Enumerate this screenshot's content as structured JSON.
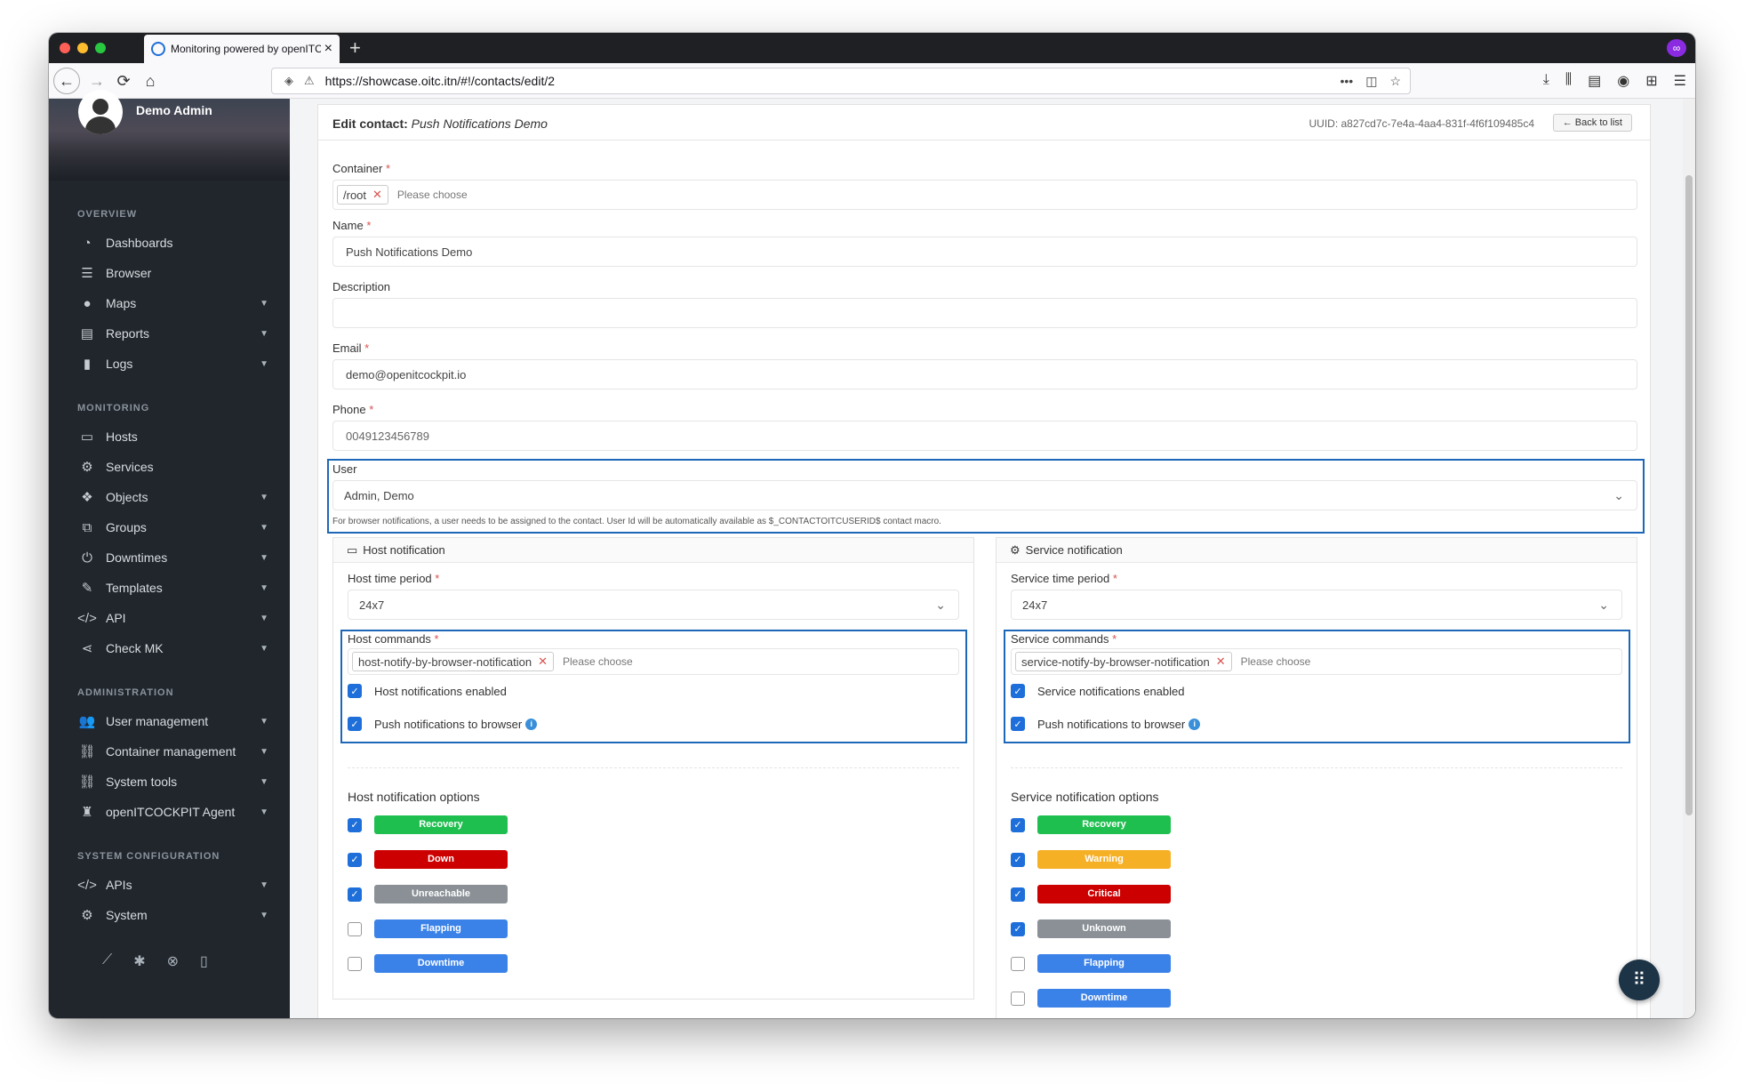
{
  "browser": {
    "tab_title": "Monitoring powered by openITC",
    "url": "https://showcase.oitc.itn/#!/contacts/edit/2"
  },
  "sidebar": {
    "user_name": "Demo Admin",
    "sections": {
      "overview": "OVERVIEW",
      "monitoring": "MONITORING",
      "administration": "ADMINISTRATION",
      "system_configuration": "SYSTEM CONFIGURATION"
    },
    "items": {
      "dashboards": "Dashboards",
      "browser": "Browser",
      "maps": "Maps",
      "reports": "Reports",
      "logs": "Logs",
      "hosts": "Hosts",
      "services": "Services",
      "objects": "Objects",
      "groups": "Groups",
      "downtimes": "Downtimes",
      "templates": "Templates",
      "api": "API",
      "checkmk": "Check MK",
      "user_management": "User management",
      "container_management": "Container management",
      "system_tools": "System tools",
      "agent": "openITCOCKPIT Agent",
      "apis": "APIs",
      "system": "System"
    }
  },
  "header": {
    "title_prefix": "Edit contact:",
    "title_name": "Push Notifications Demo",
    "uuid": "UUID: a827cd7c-7e4a-4aa4-831f-4f6f109485c4",
    "back_label": "← Back to list"
  },
  "form": {
    "container_label": "Container",
    "container_chip": "/root",
    "container_placeholder": "Please choose",
    "name_label": "Name",
    "name_value": "Push Notifications Demo",
    "description_label": "Description",
    "description_value": "",
    "email_label": "Email",
    "email_value": "demo@openitcockpit.io",
    "phone_label": "Phone",
    "phone_value": "0049123456789",
    "user_label": "User",
    "user_value": "Admin, Demo",
    "user_hint": "For browser notifications, a user needs to be assigned to the contact. User Id will be automatically available as $_CONTACTOITCUSERID$ contact macro."
  },
  "host": {
    "title": "Host notification",
    "time_period_label": "Host time period",
    "time_period_value": "24x7",
    "commands_label": "Host commands",
    "command_chip": "host-notify-by-browser-notification",
    "commands_placeholder": "Please choose",
    "enabled_label": "Host notifications enabled",
    "push_label": "Push notifications to browser",
    "options_title": "Host notification options",
    "options": [
      {
        "label": "Recovery",
        "checked": true,
        "color": "#1fbf4f"
      },
      {
        "label": "Down",
        "checked": true,
        "color": "#cc0000"
      },
      {
        "label": "Unreachable",
        "checked": true,
        "color": "#8a9096"
      },
      {
        "label": "Flapping",
        "checked": false,
        "color": "#3b82e8"
      },
      {
        "label": "Downtime",
        "checked": false,
        "color": "#3b82e8"
      }
    ]
  },
  "service": {
    "title": "Service notification",
    "time_period_label": "Service time period",
    "time_period_value": "24x7",
    "commands_label": "Service commands",
    "command_chip": "service-notify-by-browser-notification",
    "commands_placeholder": "Please choose",
    "enabled_label": "Service notifications enabled",
    "push_label": "Push notifications to browser",
    "options_title": "Service notification options",
    "options": [
      {
        "label": "Recovery",
        "checked": true,
        "color": "#1fbf4f"
      },
      {
        "label": "Warning",
        "checked": true,
        "color": "#f6b026"
      },
      {
        "label": "Critical",
        "checked": true,
        "color": "#cc0000"
      },
      {
        "label": "Unknown",
        "checked": true,
        "color": "#8a9096"
      },
      {
        "label": "Flapping",
        "checked": false,
        "color": "#3b82e8"
      },
      {
        "label": "Downtime",
        "checked": false,
        "color": "#3b82e8"
      }
    ]
  }
}
